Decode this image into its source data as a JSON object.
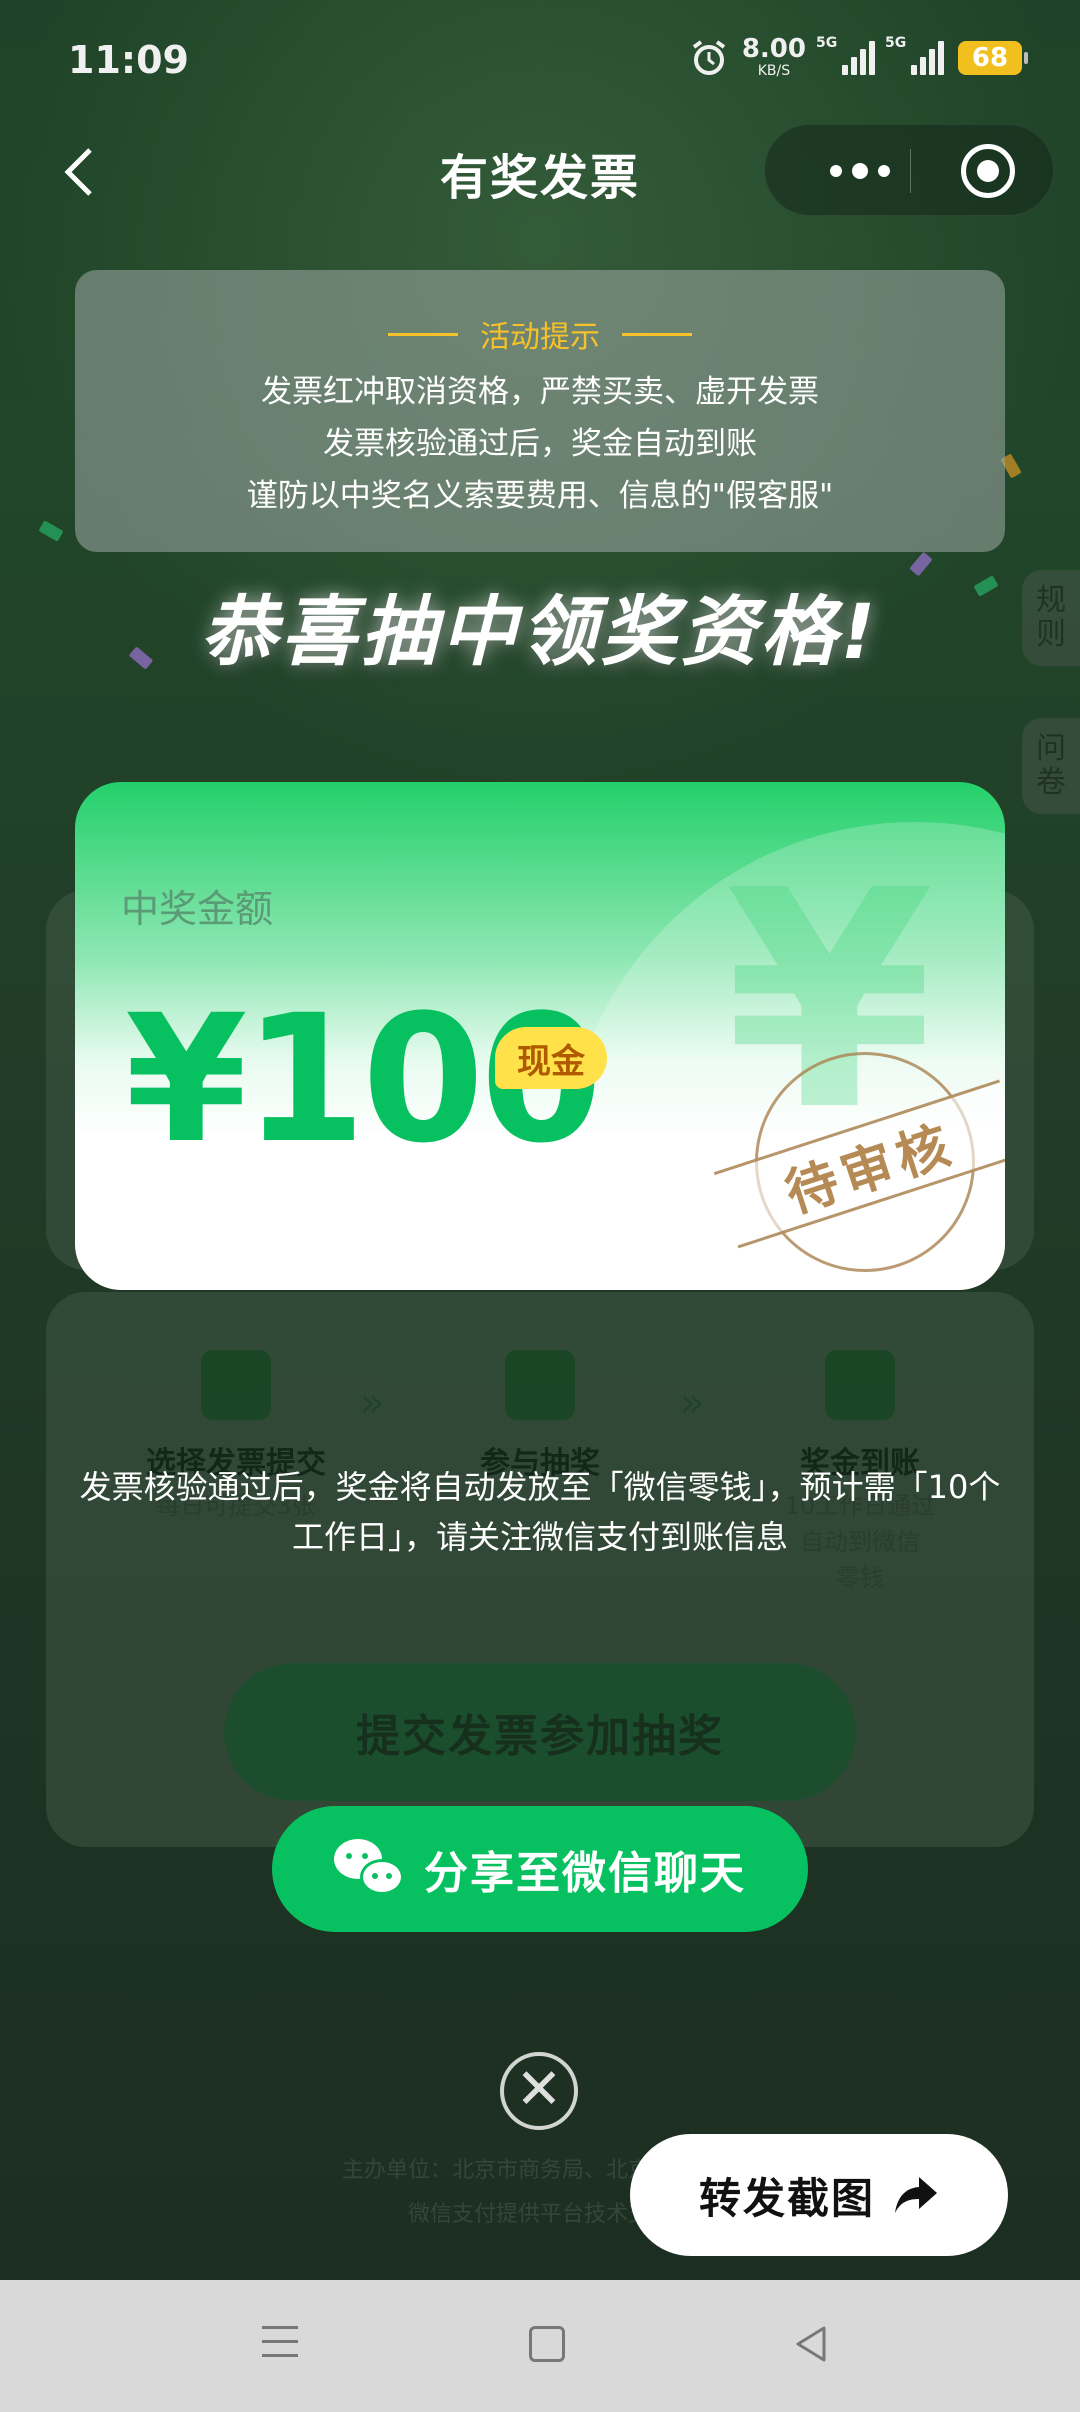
{
  "status_bar": {
    "time": "11:09",
    "net_speed": "8.00",
    "net_unit": "KB/S",
    "signal1_label": "5G",
    "signal2_label": "5G",
    "battery": "68",
    "icons": [
      "alarm-icon",
      "data-arrows-icon",
      "signal-icon",
      "signal-icon",
      "battery-icon"
    ]
  },
  "nav": {
    "title": "有奖发票",
    "back_icon": "chevron-left-icon",
    "more_icon": "more-dots-icon",
    "close_icon": "target-icon"
  },
  "background": {
    "side_tabs": [
      "规\n则",
      "问\n卷"
    ],
    "steps": [
      {
        "title": "选择发票提交",
        "desc": "每日可提交3张"
      },
      {
        "title": "参与抽奖",
        "desc": ""
      },
      {
        "title": "奖金到账",
        "desc": "10工作日通过\n自动到微信\n零钱"
      }
    ],
    "submit_label": "提交发票参加抽奖",
    "footer_line1": "主办单位：北京市商务局、北京市财政局",
    "footer_line2": "微信支付提供平台技术支持"
  },
  "notice": {
    "title": "活动提示",
    "lines": [
      "发票红冲取消资格，严禁买卖、虚开发票",
      "发票核验通过后，奖金自动到账",
      "谨防以中奖名义索要费用、信息的\"假客服\""
    ]
  },
  "congrats": "恭喜抽中领奖资格!",
  "prize": {
    "label": "中奖金额",
    "amount": "¥100",
    "badge": "现金",
    "stamp": "待审核",
    "watermark": "¥"
  },
  "info_text": "发票核验通过后，奖金将自动发放至「微信零钱」，预计需「10个工作日」，请关注微信支付到账信息",
  "share_button": {
    "label": "分享至微信聊天",
    "icon": "wechat-icon"
  },
  "close_button": {
    "icon": "close-icon",
    "glyph": "✕"
  },
  "forward_button": {
    "label": "转发截图",
    "icon": "share-arrow-icon"
  },
  "system_nav": {
    "icons": [
      "menu-icon",
      "home-icon",
      "back-icon"
    ]
  },
  "colors": {
    "accent_green": "#07c160",
    "notice_title": "#f7c12a",
    "badge_yellow": "#ffe14a",
    "stamp_brown": "#b58a55"
  }
}
